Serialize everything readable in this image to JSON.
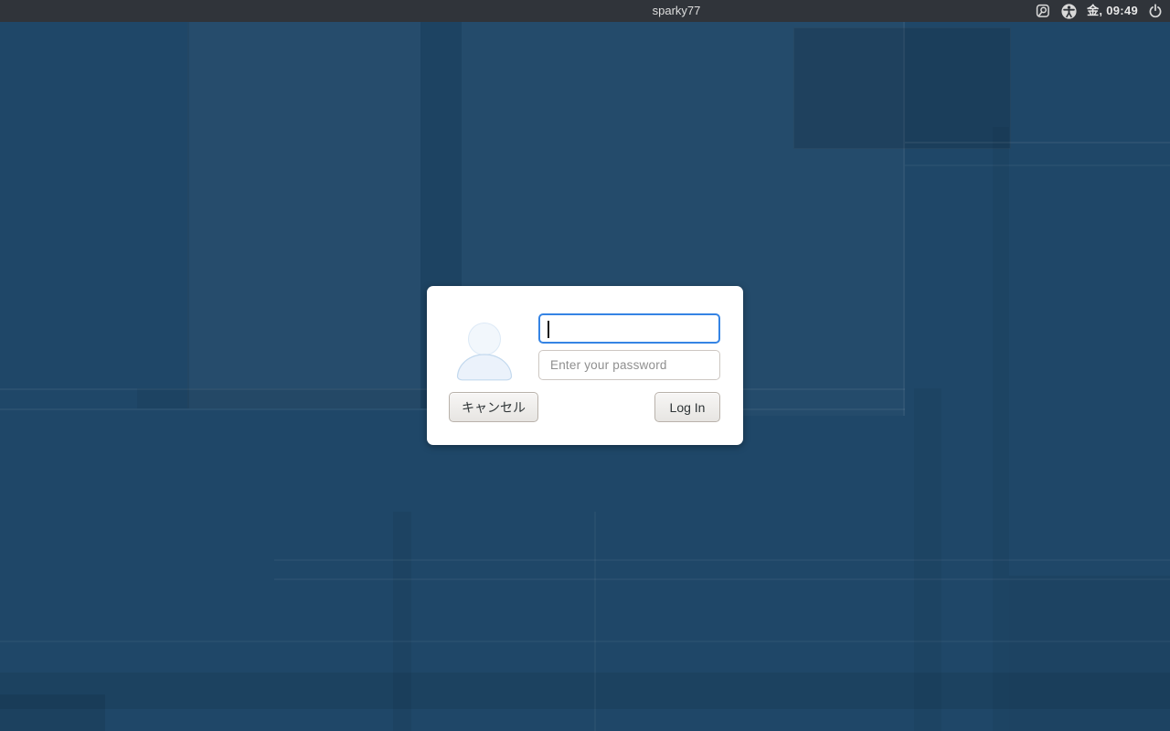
{
  "colors": {
    "top_bar_bg": "#30343a",
    "top_bar_text": "#e3e3e3",
    "desktop_base": "#1f4768",
    "dialog_bg": "#ffffff",
    "focus_blue": "#3584e4",
    "button_text": "#2e3436",
    "placeholder_gray": "#8f8f8f"
  },
  "top_bar": {
    "hostname": "sparky77",
    "clock": "金, 09:49",
    "icons": {
      "input_method": "input-method-icon",
      "accessibility": "accessibility-icon",
      "power": "power-icon"
    }
  },
  "login_dialog": {
    "avatar": "user-avatar-icon",
    "username_value": "",
    "password_placeholder": "Enter your password",
    "cancel_label": "キャンセル",
    "login_label": "Log In"
  }
}
